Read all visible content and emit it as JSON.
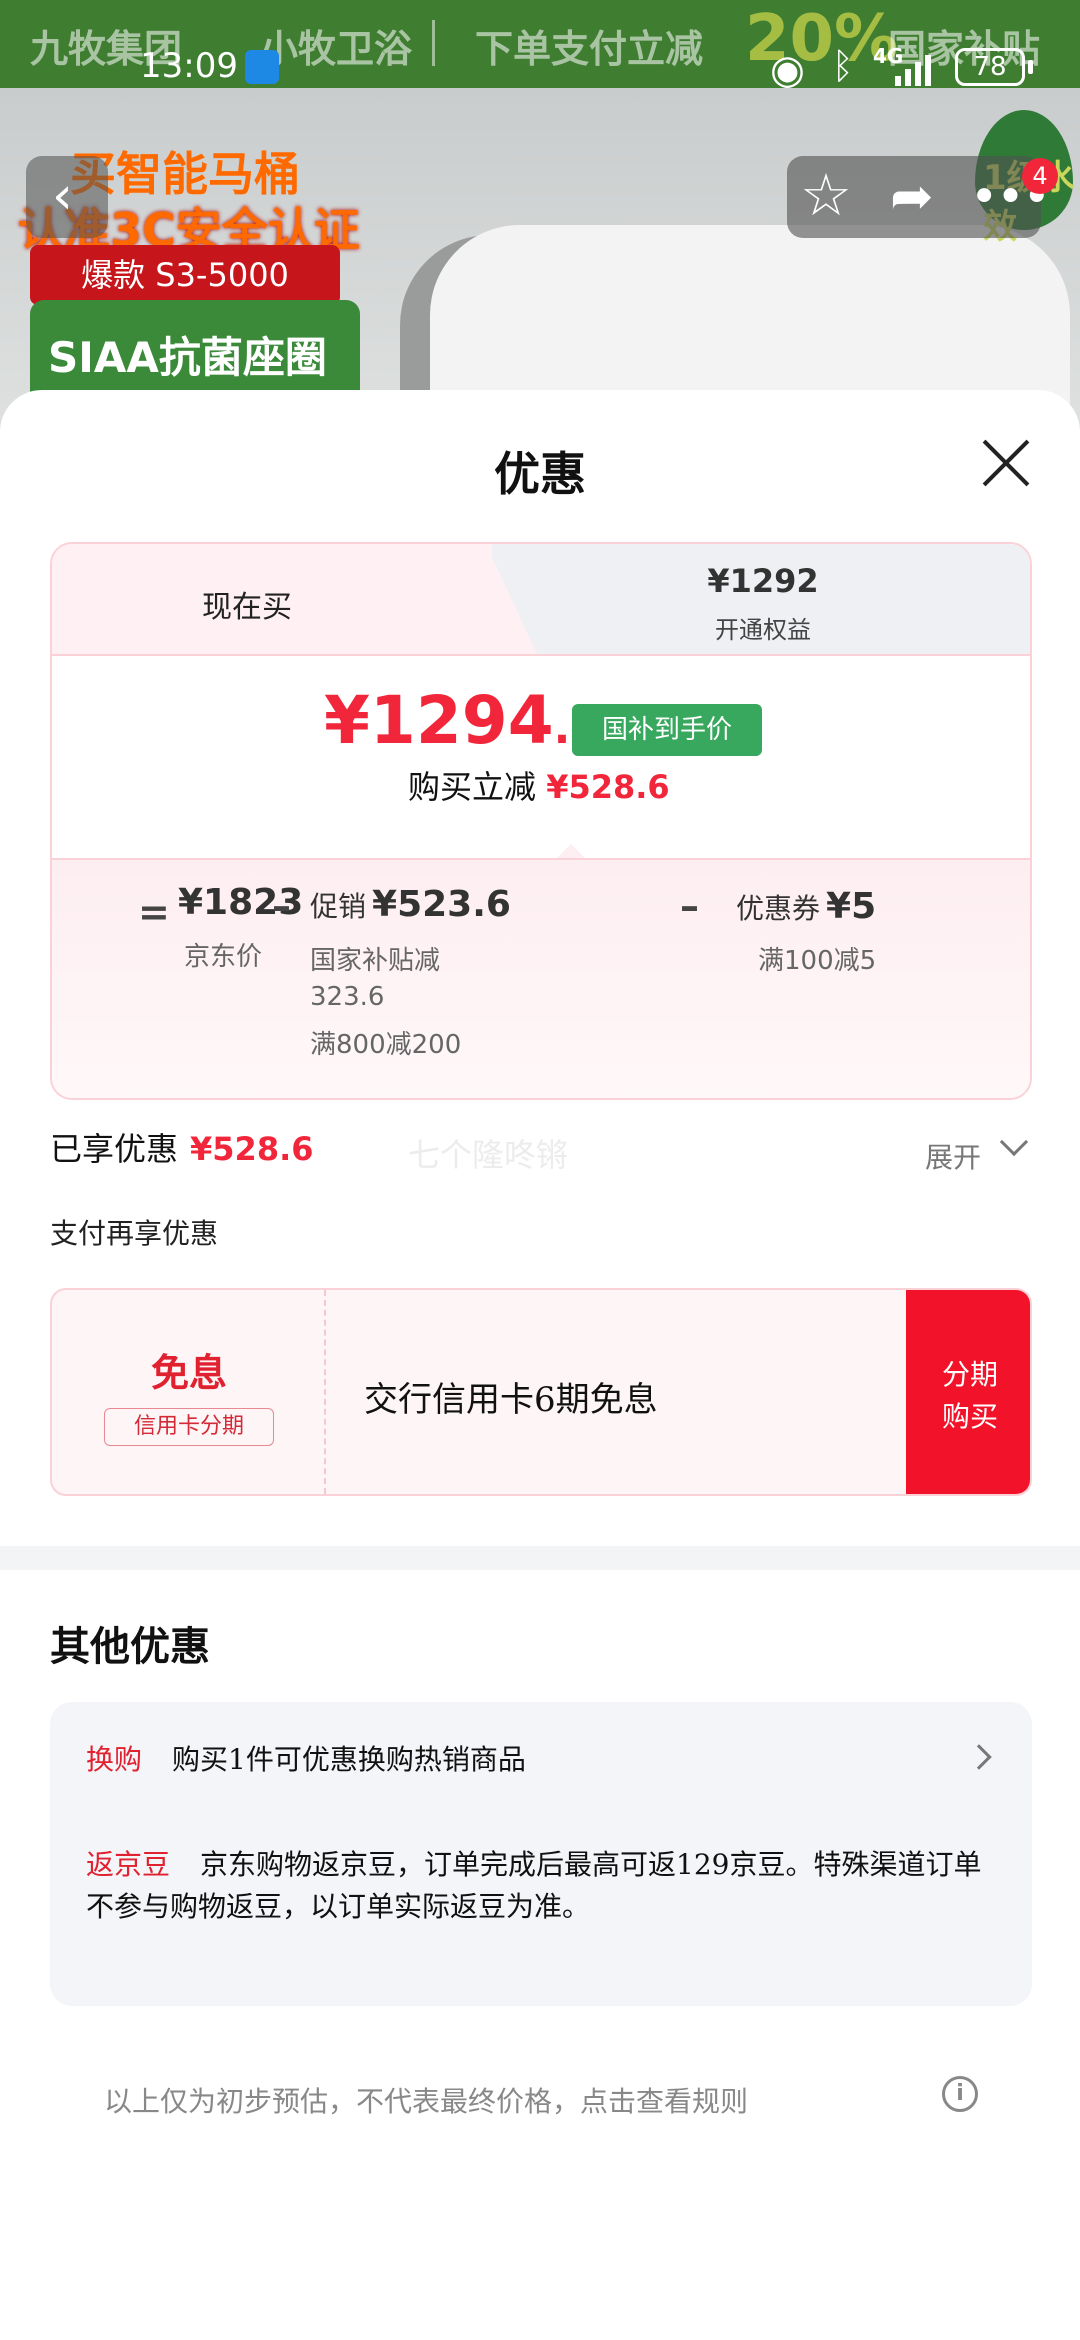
{
  "background": {
    "banner_brand": "九牧集团",
    "banner_sub": "小牧卫浴",
    "banner_promo": "下单支付立减",
    "banner_percent": "20%",
    "banner_tail": "国家补贴",
    "promo_line1": "买智能马桶",
    "promo_line2": "认准3C安全认证",
    "promo_model": "爆款 S3-5000",
    "promo_green": "SIAA抗菌座圈",
    "drop_text": "1级水效",
    "nav_badge_count": "4"
  },
  "status_bar": {
    "time": "13:09",
    "network": "4G",
    "battery": "78"
  },
  "sheet": {
    "title": "优惠",
    "tabs": {
      "now_label": "现在买",
      "member_price": "¥1292",
      "member_label": "开通权益"
    },
    "final_price_main": "¥1294",
    "final_price_decimal": ".4",
    "subsidy_tag": "国补到手价",
    "instant_cut_label": "购买立减",
    "instant_cut_value": "¥528.6",
    "breakdown": {
      "eq": "=",
      "minus": "–",
      "jd_price": "¥1823",
      "jd_price_label": "京东价",
      "promo_prefix": "促销",
      "promo_value": "¥523.6",
      "promo_detail_1": "国家补贴减",
      "promo_detail_1b": "323.6",
      "promo_detail_2": "满800减200",
      "coupon_prefix": "优惠券",
      "coupon_value": "¥5",
      "coupon_detail": "满100减5"
    },
    "enjoyed_label": "已享优惠",
    "enjoyed_value": "¥528.6",
    "watermark": "七个隆咚锵",
    "expand_label": "展开",
    "pay_more_label": "支付再享优惠",
    "installment": {
      "free_label": "免息",
      "tag": "信用卡分期",
      "text": "交行信用卡6期免息",
      "buy_line1": "分期",
      "buy_line2": "购买"
    },
    "other_title": "其他优惠",
    "other": {
      "swap_tag": "换购",
      "swap_text": "购买1件可优惠换购热销商品",
      "bean_tag": "返京豆",
      "bean_text": "京东购物返京豆，订单完成后最高可返129京豆。特殊渠道订单不参与购物返豆，以订单实际返豆为准。"
    },
    "disclaimer": "以上仅为初步预估，不代表最终价格，点击查看规则",
    "info_glyph": "i"
  },
  "colors": {
    "accent_red": "#f2263b",
    "subsidy_green": "#39a85f",
    "card_border": "#fbd1d8"
  },
  "icons": [
    "back-icon",
    "star-icon",
    "share-icon",
    "more-icon",
    "close-icon",
    "chevron-down-icon",
    "chevron-right-icon",
    "info-icon"
  ]
}
